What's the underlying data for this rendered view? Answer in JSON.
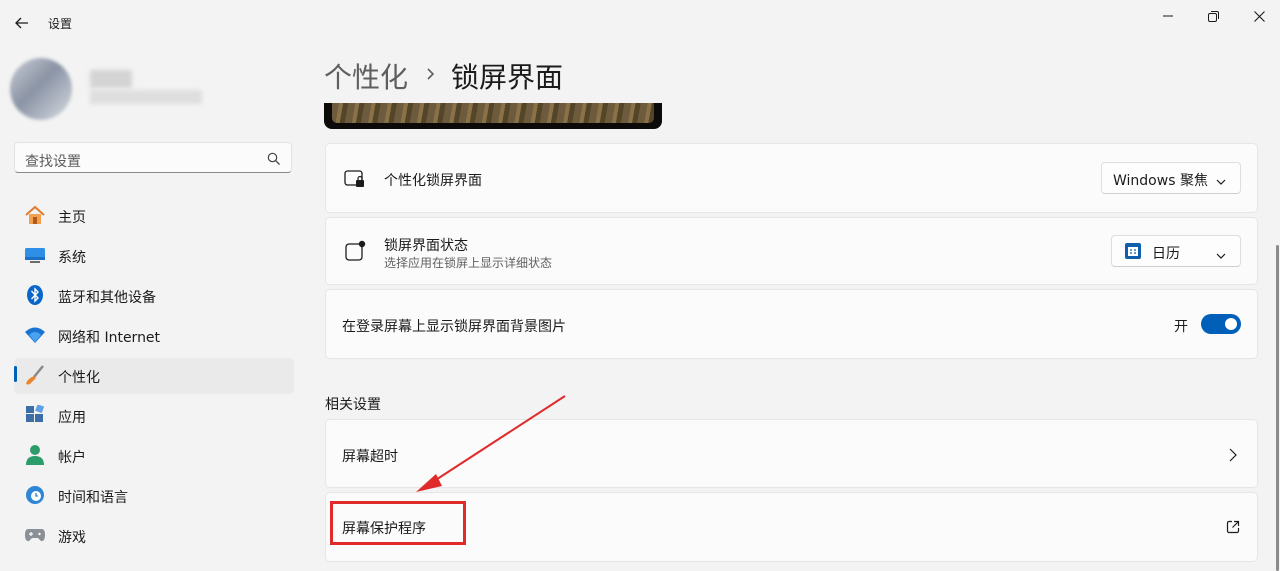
{
  "window": {
    "title": "设置",
    "controls": [
      "minimize-icon",
      "restore-icon",
      "close-icon"
    ]
  },
  "search": {
    "placeholder": "查找设置"
  },
  "sidebar": {
    "items": [
      {
        "label": "主页",
        "icon": "home-icon",
        "selected": false
      },
      {
        "label": "系统",
        "icon": "system-icon",
        "selected": false
      },
      {
        "label": "蓝牙和其他设备",
        "icon": "bluetooth-icon",
        "selected": false
      },
      {
        "label": "网络和 Internet",
        "icon": "wifi-icon",
        "selected": false
      },
      {
        "label": "个性化",
        "icon": "brush-icon",
        "selected": true
      },
      {
        "label": "应用",
        "icon": "apps-icon",
        "selected": false
      },
      {
        "label": "帐户",
        "icon": "account-icon",
        "selected": false
      },
      {
        "label": "时间和语言",
        "icon": "time-language-icon",
        "selected": false
      },
      {
        "label": "游戏",
        "icon": "gamepad-icon",
        "selected": false
      }
    ]
  },
  "breadcrumb": {
    "parent": "个性化",
    "current": "锁屏界面"
  },
  "settings": {
    "personalize_lock_screen": {
      "title": "个性化锁屏界面",
      "value": "Windows 聚焦"
    },
    "lock_screen_status": {
      "title": "锁屏界面状态",
      "subtitle": "选择应用在锁屏上显示详细状态",
      "value": "日历"
    },
    "show_background_on_signin": {
      "title": "在登录屏幕上显示锁屏界面背景图片",
      "state_label": "开",
      "on": true
    }
  },
  "related": {
    "title": "相关设置",
    "items": [
      {
        "label": "屏幕超时",
        "icon": "chevron-right-icon"
      },
      {
        "label": "屏幕保护程序",
        "icon": "external-link-icon"
      }
    ]
  },
  "colors": {
    "accent": "#005fb8",
    "annotation": "#e02b2b"
  }
}
